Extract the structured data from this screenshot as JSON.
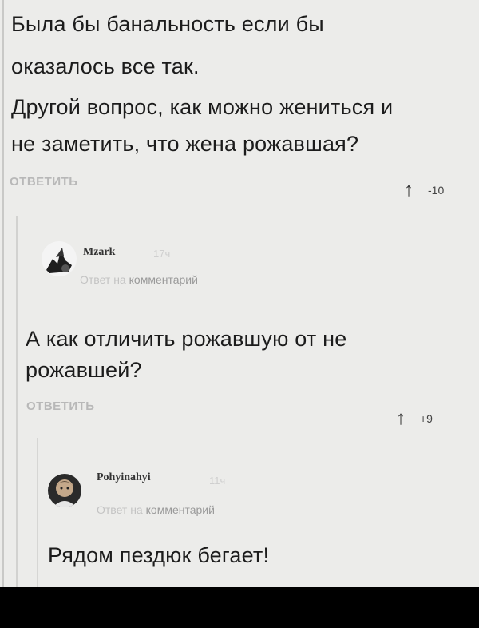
{
  "comment1": {
    "lines": [
      "Была бы банальность если бы",
      "оказалось все так.",
      "Другой вопрос, как можно жениться и",
      "не заметить, что жена рожавшая?"
    ],
    "reply_label": "ОТВЕТИТЬ",
    "rating": "-10"
  },
  "comment2": {
    "username": "Mzark",
    "time": "17ч",
    "reply_to_prefix": "Ответ на",
    "reply_to_target": "комментарий",
    "lines": [
      "А как отличить рожавшую от не",
      "рожавшей?"
    ],
    "reply_label": "ОТВЕТИТЬ",
    "rating": "+9"
  },
  "comment3": {
    "username": "Pohyinahyi",
    "time": "11ч",
    "reply_to_prefix": "Ответ на",
    "reply_to_target": "комментарий",
    "lines": [
      "Рядом пездюк бегает!"
    ]
  },
  "icons": {
    "upvote": "arrow-up-icon"
  }
}
